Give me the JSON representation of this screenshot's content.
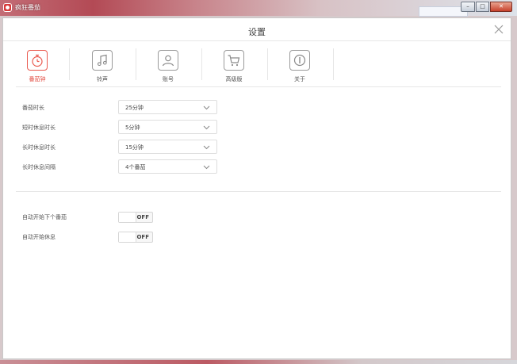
{
  "window": {
    "title": "疯狂番茄",
    "min": "–",
    "max": "□",
    "close": "✕"
  },
  "dialog": {
    "title": "设置"
  },
  "tabs": [
    {
      "label": "番茄钟",
      "icon": "stopwatch-icon",
      "active": true
    },
    {
      "label": "铃声",
      "icon": "music-note-icon",
      "active": false
    },
    {
      "label": "账号",
      "icon": "user-icon",
      "active": false
    },
    {
      "label": "高级版",
      "icon": "cart-icon",
      "active": false
    },
    {
      "label": "关于",
      "icon": "info-icon",
      "active": false
    }
  ],
  "durations": [
    {
      "label": "番茄时长",
      "value": "25分钟"
    },
    {
      "label": "短时休息时长",
      "value": "5分钟"
    },
    {
      "label": "长时休息时长",
      "value": "15分钟"
    },
    {
      "label": "长时休息间隔",
      "value": "4个番茄"
    }
  ],
  "toggles": [
    {
      "label": "自动开始下个番茄",
      "state": "OFF"
    },
    {
      "label": "自动开始休息",
      "state": "OFF"
    }
  ],
  "colors": {
    "accent": "#e2483d",
    "border": "#dedede",
    "text": "#444444"
  }
}
